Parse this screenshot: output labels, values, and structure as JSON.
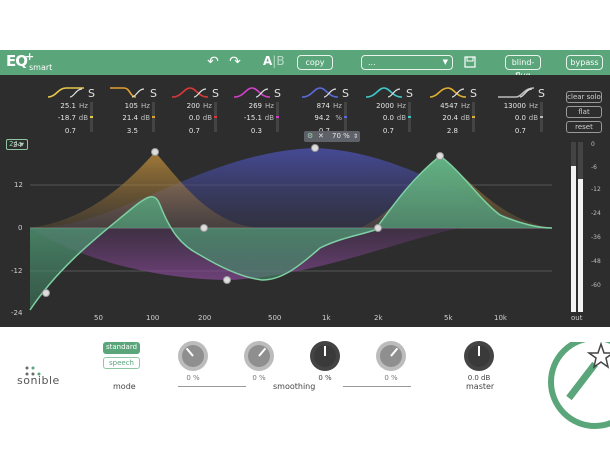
{
  "header": {
    "logo_mark": "EQ",
    "logo_plus": "+",
    "logo_sub": "smart",
    "ab_a": "A",
    "ab_sep": "|",
    "ab_b": "B",
    "copy_label": "copy",
    "preset_value": "...",
    "blind_label": "blind-flug",
    "bypass_label": "bypass"
  },
  "bands": [
    {
      "freq": "25.1",
      "freq_unit": "Hz",
      "gain": "-18.7",
      "gain_unit": "dB",
      "q": "0.7",
      "solo": "S",
      "color": "#e6c84a"
    },
    {
      "freq": "105",
      "freq_unit": "Hz",
      "gain": "21.4",
      "gain_unit": "dB",
      "q": "3.5",
      "solo": "S",
      "color": "#e0a030"
    },
    {
      "freq": "200",
      "freq_unit": "Hz",
      "gain": "0.0",
      "gain_unit": "dB",
      "q": "0.7",
      "solo": "S",
      "color": "#d83838"
    },
    {
      "freq": "269",
      "freq_unit": "Hz",
      "gain": "-15.1",
      "gain_unit": "dB",
      "q": "0.3",
      "solo": "S",
      "color": "#d040c8"
    },
    {
      "freq": "874",
      "freq_unit": "Hz",
      "gain": "94.2",
      "gain_unit": "%",
      "q": "0.7",
      "solo": "S",
      "color": "#5a6ad8"
    },
    {
      "freq": "2000",
      "freq_unit": "Hz",
      "gain": "0.0",
      "gain_unit": "dB",
      "q": "0.7",
      "solo": "S",
      "color": "#40c8c8"
    },
    {
      "freq": "4547",
      "freq_unit": "Hz",
      "gain": "20.4",
      "gain_unit": "dB",
      "q": "2.8",
      "solo": "S",
      "color": "#e0b030"
    },
    {
      "freq": "13000",
      "freq_unit": "Hz",
      "gain": "0.0",
      "gain_unit": "dB",
      "q": "0.7",
      "solo": "S",
      "color": "#bbbbbb"
    }
  ],
  "side_buttons": {
    "clear_solo": "clear solo",
    "flat": "flat",
    "reset": "reset"
  },
  "range_select": "24",
  "auto_bar": {
    "percent": "70 %"
  },
  "y_axis": [
    "24",
    "12",
    "0",
    "-12",
    "-24"
  ],
  "x_axis": [
    "50",
    "100",
    "200",
    "500",
    "1k",
    "2k",
    "5k",
    "10k"
  ],
  "meter_scale": [
    "0",
    "-6",
    "-12",
    "-24",
    "-36",
    "-48",
    "-60"
  ],
  "meter_label": "out",
  "meter_level": {
    "left": 0.86,
    "right": 0.78
  },
  "brand": "sonible",
  "mode": {
    "label": "mode",
    "options": [
      "standard",
      "speech"
    ],
    "selected": "standard"
  },
  "smoothing": {
    "label": "smoothing",
    "knobs": [
      {
        "value": "0 %"
      },
      {
        "value": "0 %"
      },
      {
        "value": "0 %"
      },
      {
        "value": "0 %"
      }
    ]
  },
  "master": {
    "value": "0.0 dB",
    "label": "master"
  },
  "colors": {
    "accent": "#5aa57a",
    "background": "#2d2d2d",
    "curve": "#6cc493"
  }
}
